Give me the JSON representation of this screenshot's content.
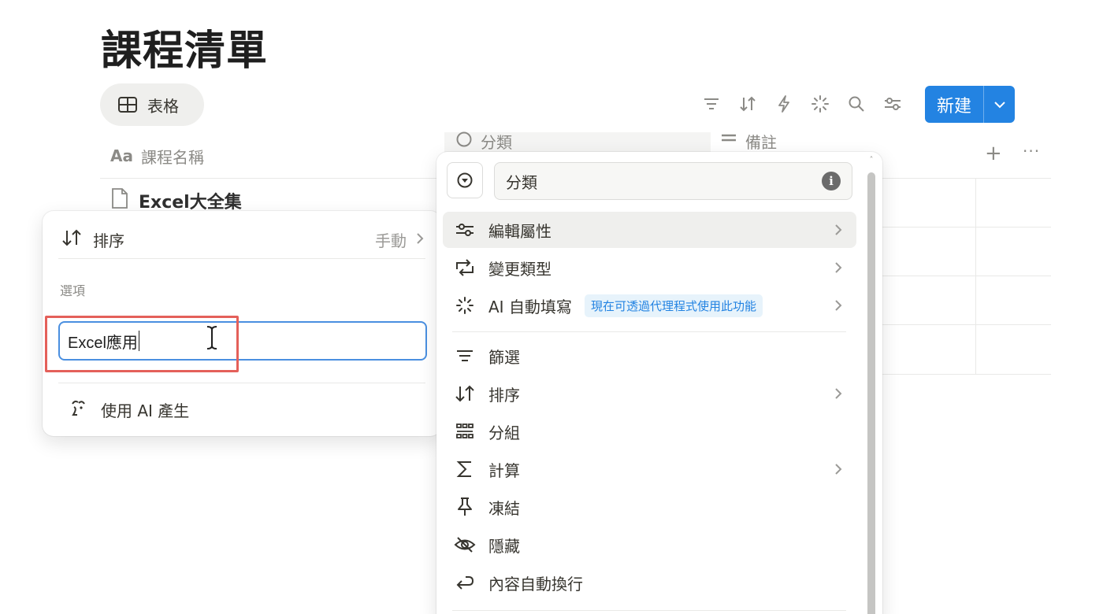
{
  "page": {
    "title": "課程清單"
  },
  "view_tab": {
    "label": "表格"
  },
  "toolbar": {
    "new_label": "新建"
  },
  "table": {
    "columns": [
      {
        "prefix": "Aa",
        "label": "課程名稱"
      },
      {
        "label": "分類"
      },
      {
        "label": "備註"
      }
    ],
    "rows": [
      {
        "name": "Excel大全集"
      }
    ]
  },
  "left_panel": {
    "sort_label": "排序",
    "sort_value": "手動",
    "options_heading": "選項",
    "input_value": "Excel應用",
    "ai_label": "使用 AI 產生"
  },
  "right_panel": {
    "property_name": "分類",
    "info_glyph": "i",
    "items": [
      {
        "label": "編輯屬性"
      },
      {
        "label": "變更類型"
      },
      {
        "label": "AI 自動填寫",
        "badge": "現在可透過代理程式使用此功能"
      },
      {
        "label": "篩選"
      },
      {
        "label": "排序"
      },
      {
        "label": "分組"
      },
      {
        "label": "計算"
      },
      {
        "label": "凍結"
      },
      {
        "label": "隱藏"
      },
      {
        "label": "內容自動換行"
      }
    ]
  },
  "colors": {
    "accent": "#2383e2",
    "highlight": "#e4605a"
  }
}
